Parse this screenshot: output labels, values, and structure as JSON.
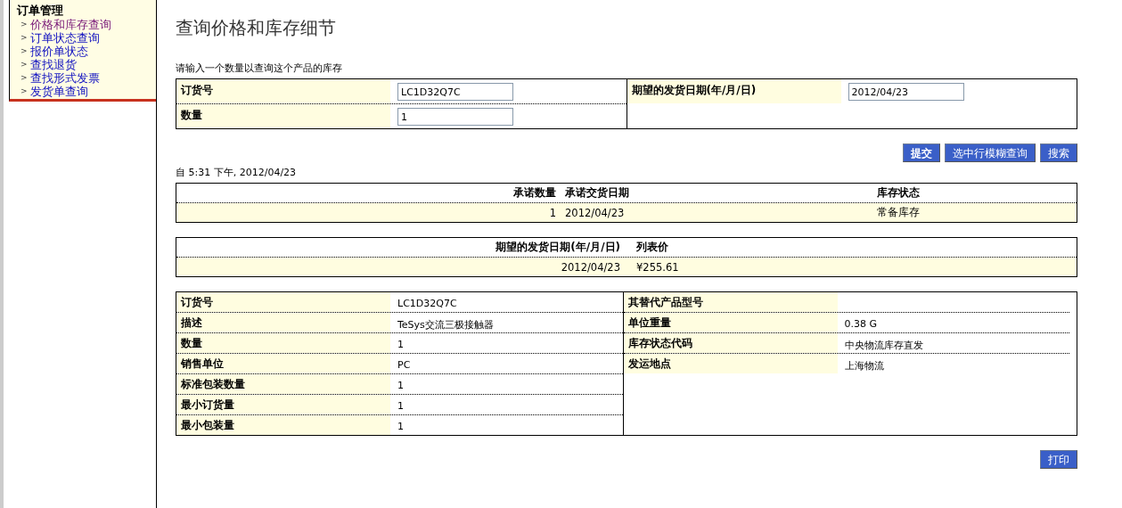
{
  "sidebar": {
    "title": "订单管理",
    "items": [
      {
        "marker": ">",
        "label": "价格和库存查询",
        "selected": true
      },
      {
        "marker": ">",
        "label": "订单状态查询",
        "selected": false
      },
      {
        "marker": ">",
        "label": "报价单状态",
        "selected": false
      },
      {
        "marker": ">",
        "label": "查找退货",
        "selected": false
      },
      {
        "marker": ">",
        "label": "查找形式发票",
        "selected": false
      },
      {
        "marker": ">",
        "label": "发货单查询",
        "selected": false
      }
    ]
  },
  "page_title": "查询价格和库存细节",
  "instruction": "请输入一个数量以查询这个产品的库存",
  "form": {
    "left": [
      {
        "label": "订货号",
        "value": "LC1D32Q7C"
      },
      {
        "label": "数量",
        "value": "1"
      }
    ],
    "right": [
      {
        "label": "期望的发货日期(年/月/日)",
        "value": "2012/04/23"
      }
    ]
  },
  "buttons": [
    "提交",
    "选中行模糊查询",
    "搜索"
  ],
  "as_of": "自 5:31 下午, 2012/04/23",
  "availability": {
    "columns": [
      "承诺数量",
      "承诺交货日期",
      "库存状态"
    ],
    "row": [
      "1",
      "2012/04/23",
      "常备库存"
    ]
  },
  "pricing": {
    "columns": [
      "期望的发货日期(年/月/日)",
      "列表价"
    ],
    "row": [
      "2012/04/23",
      "¥255.61"
    ]
  },
  "details": {
    "left": [
      {
        "label": "订货号",
        "value": "LC1D32Q7C"
      },
      {
        "label": "描述",
        "value": "TeSys交流三极接触器"
      },
      {
        "label": "数量",
        "value": "1"
      },
      {
        "label": "销售单位",
        "value": "PC"
      },
      {
        "label": "标准包装数量",
        "value": "1"
      },
      {
        "label": "最小订货量",
        "value": "1"
      },
      {
        "label": "最小包装量",
        "value": "1"
      }
    ],
    "right": [
      {
        "label": "其替代产品型号"
      },
      {
        "label": "单位重量",
        "value": "0.38 G"
      },
      {
        "label": "库存状态代码",
        "value": "中央物流库存直发"
      },
      {
        "label": "发运地点",
        "value": "上海物流"
      }
    ]
  },
  "print_button": "打印"
}
